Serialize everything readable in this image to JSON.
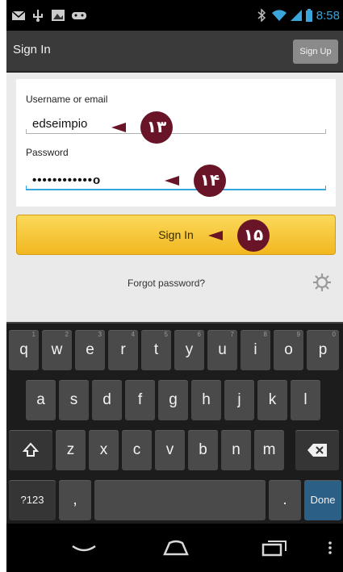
{
  "status_bar": {
    "time": "8:58",
    "icons": [
      "mail-icon",
      "usb-icon",
      "image-icon",
      "gamepad-icon",
      "bluetooth-icon",
      "wifi-icon",
      "signal-icon",
      "battery-icon"
    ]
  },
  "action_bar": {
    "title": "Sign In",
    "signup_label": "Sign Up"
  },
  "form": {
    "username_label": "Username or email",
    "username_value": "edseimpio",
    "password_label": "Password",
    "password_value": "••••••••••••o",
    "signin_label": "Sign In",
    "forgot_label": "Forgot password?"
  },
  "callouts": {
    "username": "۱۳",
    "password": "۱۴",
    "signin": "۱۵",
    "color": "#6a1428"
  },
  "keyboard": {
    "row1": [
      {
        "label": "q",
        "sub": "1"
      },
      {
        "label": "w",
        "sub": "2"
      },
      {
        "label": "e",
        "sub": "3"
      },
      {
        "label": "r",
        "sub": "4"
      },
      {
        "label": "t",
        "sub": "5"
      },
      {
        "label": "y",
        "sub": "6"
      },
      {
        "label": "u",
        "sub": "7"
      },
      {
        "label": "i",
        "sub": "8"
      },
      {
        "label": "o",
        "sub": "9"
      },
      {
        "label": "p",
        "sub": "0"
      }
    ],
    "row2": [
      "a",
      "s",
      "d",
      "f",
      "g",
      "h",
      "j",
      "k",
      "l"
    ],
    "row3": [
      "z",
      "x",
      "c",
      "v",
      "b",
      "n",
      "m"
    ],
    "symbols_label": "?123",
    "comma_label": ",",
    "period_label": ".",
    "done_label": "Done"
  },
  "colors": {
    "accent": "#35a6e0",
    "signin_button": "#f5c232",
    "done_key": "#2b5f86"
  }
}
